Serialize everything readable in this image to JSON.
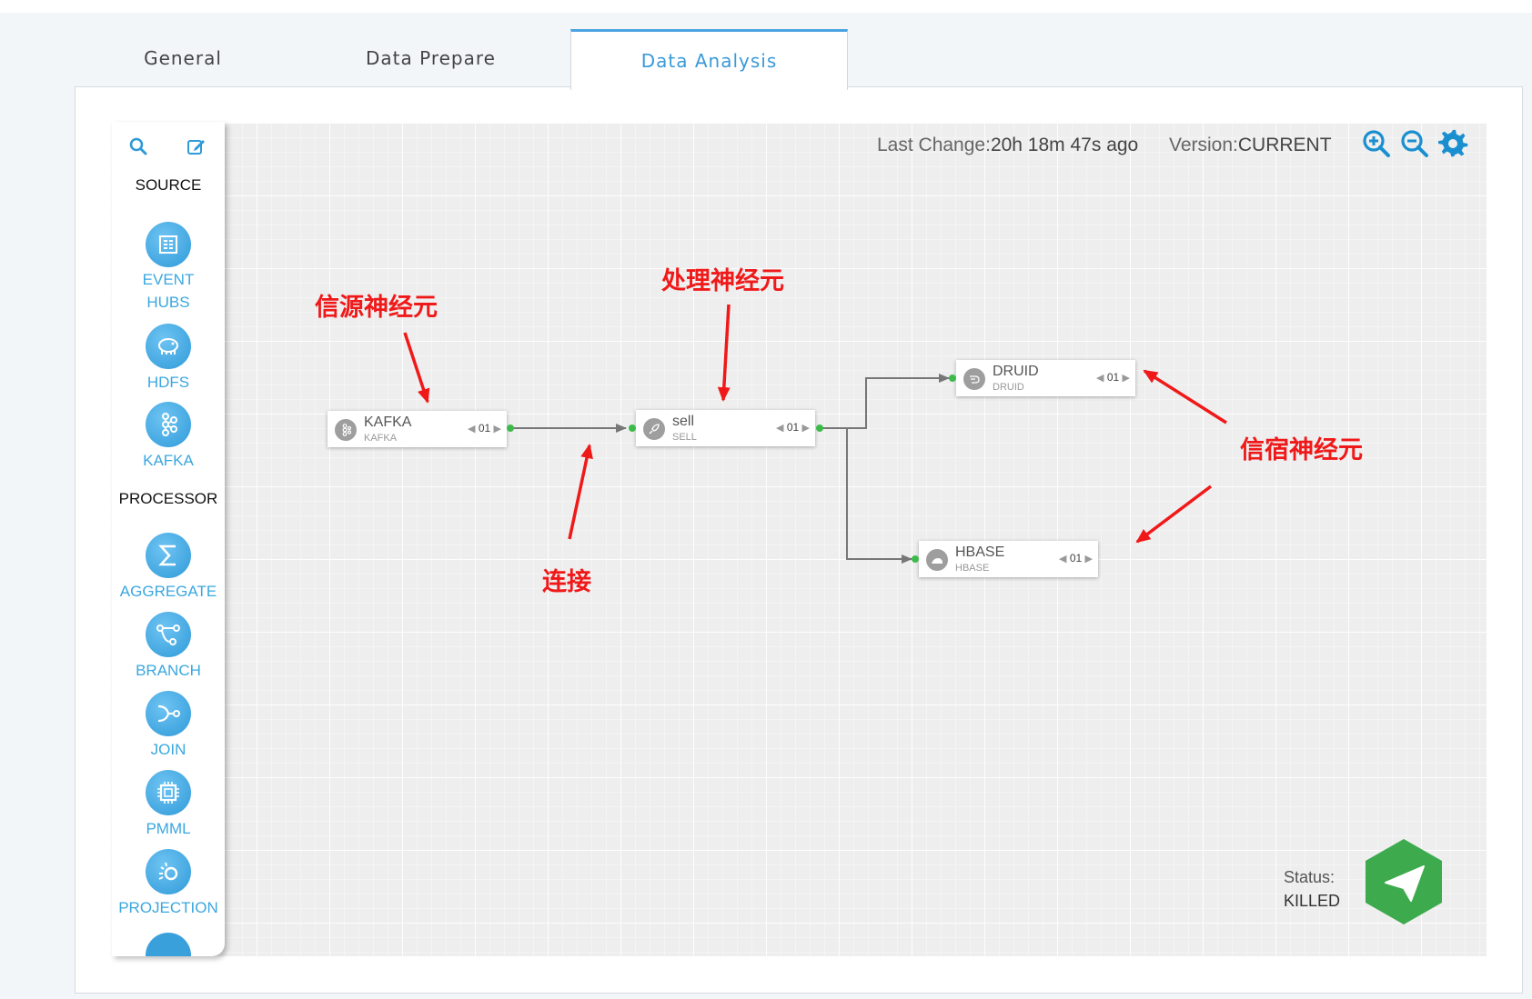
{
  "tabs": [
    {
      "label": "General"
    },
    {
      "label": "Data Prepare"
    },
    {
      "label": "Data Analysis"
    }
  ],
  "sidebar": {
    "search_icon": "search-icon",
    "edit_icon": "edit-icon",
    "source_heading": "SOURCE",
    "processor_heading": "PROCESSOR",
    "sources": [
      {
        "label_line1": "EVENT",
        "label_line2": "HUBS",
        "icon": "event-hubs-icon"
      },
      {
        "label_line1": "HDFS",
        "icon": "hdfs-elephant-icon"
      },
      {
        "label_line1": "KAFKA",
        "icon": "kafka-icon"
      }
    ],
    "processors": [
      {
        "label_line1": "AGGREGATE",
        "icon": "sigma-icon"
      },
      {
        "label_line1": "BRANCH",
        "icon": "branch-icon"
      },
      {
        "label_line1": "JOIN",
        "icon": "join-icon"
      },
      {
        "label_line1": "PMML",
        "icon": "chip-icon"
      },
      {
        "label_line1": "PROJECTION",
        "icon": "projection-icon"
      }
    ]
  },
  "info": {
    "last_change_label": "Last Change:",
    "last_change_value": "20h 18m 47s ago",
    "version_label": "Version:",
    "version_value": "CURRENT"
  },
  "toolbar": {
    "zoom_in": "zoom-in-icon",
    "zoom_out": "zoom-out-icon",
    "settings": "gear-icon"
  },
  "nodes": {
    "kafka": {
      "title": "KAFKA",
      "subtitle": "KAFKA",
      "count": "01"
    },
    "sell": {
      "title": "sell",
      "subtitle": "SELL",
      "count": "01"
    },
    "druid": {
      "title": "DRUID",
      "subtitle": "DRUID",
      "count": "01"
    },
    "hbase": {
      "title": "HBASE",
      "subtitle": "HBASE",
      "count": "01"
    }
  },
  "annotations": {
    "source_neuron": "信源神经元",
    "processor_neuron": "处理神经元",
    "connection": "连接",
    "sink_neuron": "信宿神经元"
  },
  "status": {
    "label": "Status:",
    "value": "KILLED"
  },
  "colors": {
    "accent": "#3a9ad9",
    "annotation": "#f01919",
    "port": "#3dbb4a",
    "deploy": "#3dab4d"
  }
}
